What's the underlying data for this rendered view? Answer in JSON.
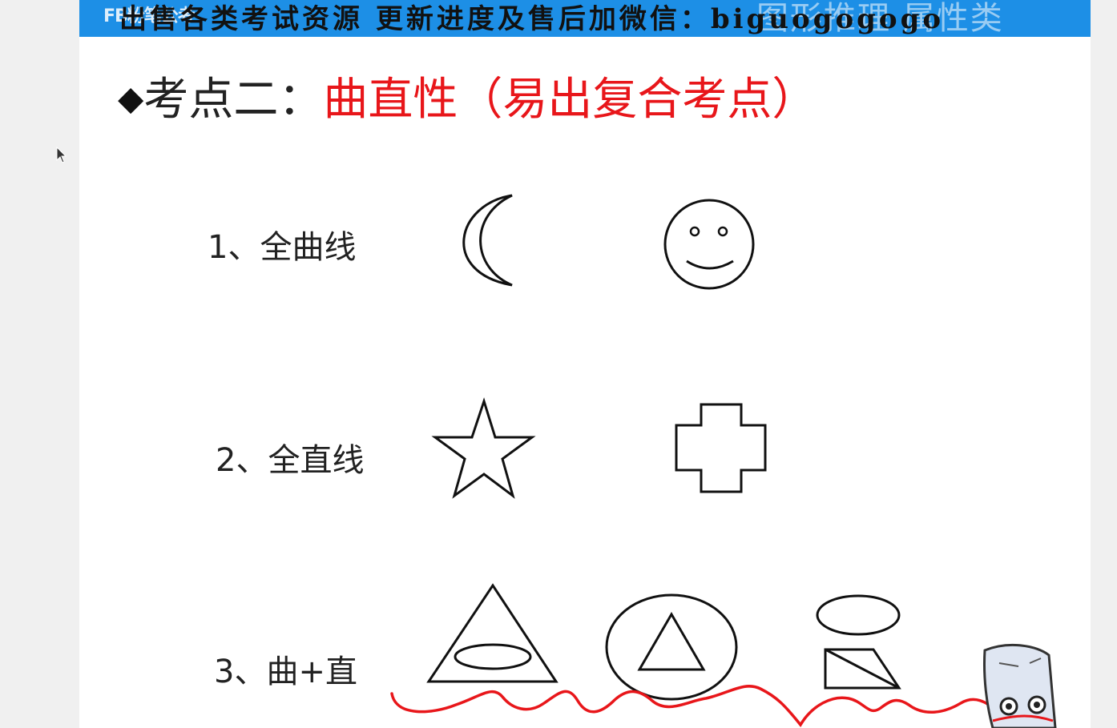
{
  "banner": {
    "logo": "FB粉笔公考",
    "faint_text": "图形推理  属性类",
    "text": "出售各类考试资源 更新进度及售后加微信：biguogogogo"
  },
  "title": {
    "bullet": "◆",
    "prefix": "考点二：",
    "highlight": "曲直性（易出复合考点）"
  },
  "rows": [
    {
      "label": "1、全曲线",
      "shapes": [
        "crescent-moon-icon",
        "smiley-face-icon"
      ]
    },
    {
      "label": "2、全直线",
      "shapes": [
        "star-icon",
        "plus-cross-icon"
      ]
    },
    {
      "label": "3、曲+直",
      "shapes": [
        "triangle-with-ellipse-icon",
        "circle-with-triangle-icon",
        "ellipse-and-trapezoid-icon"
      ]
    }
  ],
  "colors": {
    "banner": "#1d8fe6",
    "title_highlight": "#e8161a",
    "annotation": "#e8161a"
  }
}
